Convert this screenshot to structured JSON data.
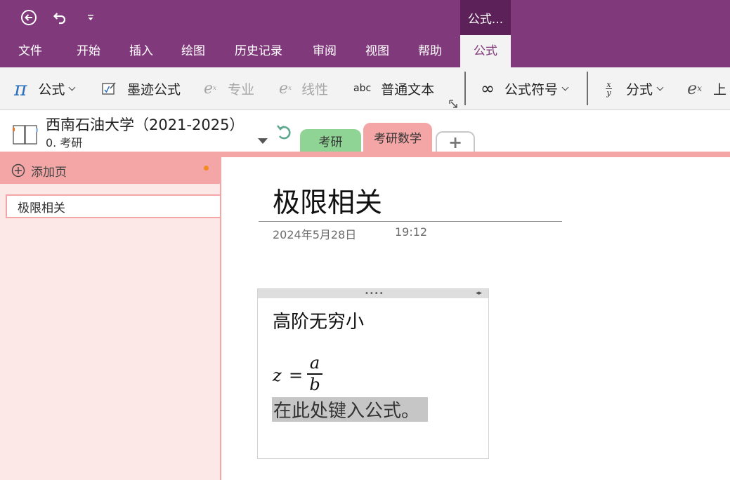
{
  "title_bar": {
    "context_title": "公式..."
  },
  "menu": {
    "tabs": [
      {
        "label": "文件"
      },
      {
        "label": "开始"
      },
      {
        "label": "插入"
      },
      {
        "label": "绘图"
      },
      {
        "label": "历史记录"
      },
      {
        "label": "审阅"
      },
      {
        "label": "视图"
      },
      {
        "label": "帮助"
      }
    ],
    "active_tab": "公式"
  },
  "ribbon": {
    "equation": "公式",
    "ink_equation": "墨迹公式",
    "professional": "专业",
    "linear": "线性",
    "normal_text_icon": "abc",
    "normal_text": "普通文本",
    "symbols": "公式符号",
    "fraction": "分式",
    "script": "上"
  },
  "notebook": {
    "name": "西南石油大学（2021-2025）",
    "section_group": "0. 考研",
    "sections": [
      {
        "label": "考研"
      },
      {
        "label": "考研数学"
      }
    ],
    "add_section": "+"
  },
  "page_pane": {
    "add_page": "添加页",
    "pages": [
      {
        "label": "极限相关"
      }
    ]
  },
  "page": {
    "title": "极限相关",
    "date": "2024年5月28日",
    "time": "19:12",
    "note": {
      "heading": "高阶无穷小",
      "formula": {
        "lhs": "z",
        "op": "=",
        "numerator": "a",
        "denominator": "b"
      },
      "placeholder": "在此处键入公式。"
    }
  },
  "colors": {
    "brand": "#80397b",
    "context_tab": "#5d2159",
    "section_green": "#8fd494",
    "section_pink": "#f4a6a6",
    "pane_bg": "#fde8e8"
  },
  "icons": [
    "back-icon",
    "undo-icon",
    "customize-qat-icon",
    "pi-icon",
    "ink-equation-icon",
    "professional-icon",
    "linear-icon",
    "dialog-launcher-icon",
    "infinity-icon",
    "fraction-icon",
    "script-icon",
    "notebook-icon",
    "dropdown-icon",
    "sync-icon",
    "add-page-icon",
    "unsaved-dot-icon"
  ]
}
